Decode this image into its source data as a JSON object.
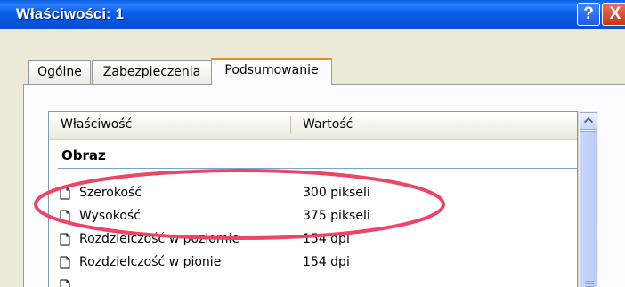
{
  "window": {
    "title": "Właściwości: 1"
  },
  "titlebar": {
    "help_label": "?",
    "close_label": "X"
  },
  "tabs": [
    "Ogólne",
    "Zabezpieczenia",
    "Podsumowanie"
  ],
  "list": {
    "headers": {
      "property": "Właściwość",
      "value": "Wartość"
    },
    "group_title": "Obraz",
    "rows": [
      {
        "name": "Szerokość",
        "value": "300 pikseli"
      },
      {
        "name": "Wysokość",
        "value": "375 pikseli"
      },
      {
        "name": "Rozdzielczość w poziomie",
        "value": "154 dpi"
      },
      {
        "name": "Rozdzielczość w pionie",
        "value": "154 dpi"
      }
    ]
  },
  "highlight": {
    "color": "#ef4466"
  }
}
